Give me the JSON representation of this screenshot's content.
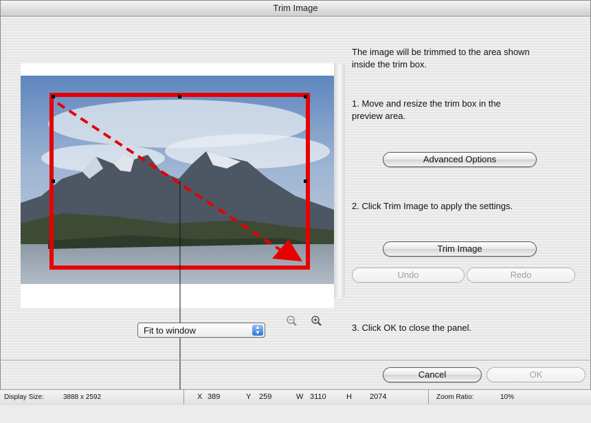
{
  "window": {
    "title": "Trim Image"
  },
  "instructions": {
    "intro_line1": "The image will be trimmed to the area shown",
    "intro_line2": "inside the trim box.",
    "step1_line1": "1.  Move and resize the trim box in the",
    "step1_line2": "preview area.",
    "step2": "2. Click Trim Image to apply the settings.",
    "step3": "3. Click OK to close the panel."
  },
  "buttons": {
    "advanced": "Advanced Options",
    "trim": "Trim Image",
    "undo": "Undo",
    "redo": "Redo",
    "cancel": "Cancel",
    "ok": "OK"
  },
  "zoom": {
    "selected": "Fit to window",
    "zoom_out_icon": "zoom-out-icon",
    "zoom_in_icon": "zoom-in-icon"
  },
  "status": {
    "display_size_label": "Display Size:",
    "display_size_value": "3888 x 2592",
    "x_label": "X",
    "x_value": "389",
    "y_label": "Y",
    "y_value": "259",
    "w_label": "W",
    "w_value": "3110",
    "h_label": "H",
    "h_value": "2074",
    "zoom_label": "Zoom Ratio:",
    "zoom_value": "10%"
  },
  "colors": {
    "trim_box": "#e60000",
    "arrow": "#e60000"
  }
}
